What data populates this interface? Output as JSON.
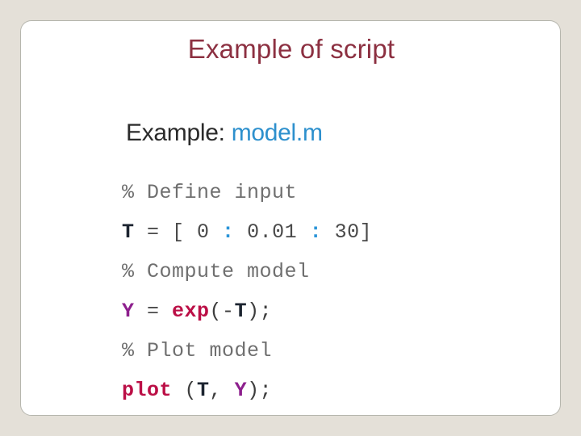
{
  "slide": {
    "title": "Example of script",
    "title_color": "#8c3041",
    "background_color": "#e4e0d8",
    "card_color": "#ffffff",
    "border_color": "#b6b6ae"
  },
  "content": {
    "heading_label": "Example: ",
    "heading_filename": "model.m",
    "heading_label_color": "#2b2b2b",
    "heading_filename_color": "#2d90cd"
  },
  "code": {
    "colors": {
      "comment": "#6f6f6f",
      "variable_t": "#1c2430",
      "variable_y": "#8d1f8d",
      "colon": "#2a94d8",
      "function": "#bb0f46",
      "punctuation": "#3d3d3d"
    },
    "lines": [
      {
        "id": "comment-define-input",
        "text": "% Define input",
        "tokens": [
          {
            "t": "% Define input",
            "c": "tok-comment"
          }
        ]
      },
      {
        "id": "assign-t",
        "text": "T = [ 0 : 0.01 : 30]",
        "tokens": [
          {
            "t": "T",
            "c": "tok-var-t"
          },
          {
            "t": " = ",
            "c": "tok-plain"
          },
          {
            "t": "[ 0 ",
            "c": "tok-num"
          },
          {
            "t": ":",
            "c": "tok-colon"
          },
          {
            "t": " 0.01 ",
            "c": "tok-num"
          },
          {
            "t": ":",
            "c": "tok-colon"
          },
          {
            "t": " 30]",
            "c": "tok-num"
          }
        ]
      },
      {
        "id": "comment-compute-model",
        "text": "% Compute model",
        "tokens": [
          {
            "t": "% Compute model",
            "c": "tok-comment"
          }
        ]
      },
      {
        "id": "assign-y",
        "text": "Y = exp(-T);",
        "tokens": [
          {
            "t": "Y",
            "c": "tok-var-y"
          },
          {
            "t": " = ",
            "c": "tok-plain"
          },
          {
            "t": "exp",
            "c": "tok-func"
          },
          {
            "t": "(-",
            "c": "tok-punct"
          },
          {
            "t": "T",
            "c": "tok-var-t"
          },
          {
            "t": ");",
            "c": "tok-punct"
          }
        ]
      },
      {
        "id": "comment-plot-model",
        "text": "% Plot model",
        "tokens": [
          {
            "t": "% Plot model",
            "c": "tok-comment"
          }
        ]
      },
      {
        "id": "call-plot",
        "text": "plot (T, Y);",
        "tokens": [
          {
            "t": "plot",
            "c": "tok-func"
          },
          {
            "t": " (",
            "c": "tok-punct"
          },
          {
            "t": "T",
            "c": "tok-var-t"
          },
          {
            "t": ", ",
            "c": "tok-punct"
          },
          {
            "t": "Y",
            "c": "tok-var-y"
          },
          {
            "t": ");",
            "c": "tok-punct"
          }
        ]
      }
    ]
  }
}
